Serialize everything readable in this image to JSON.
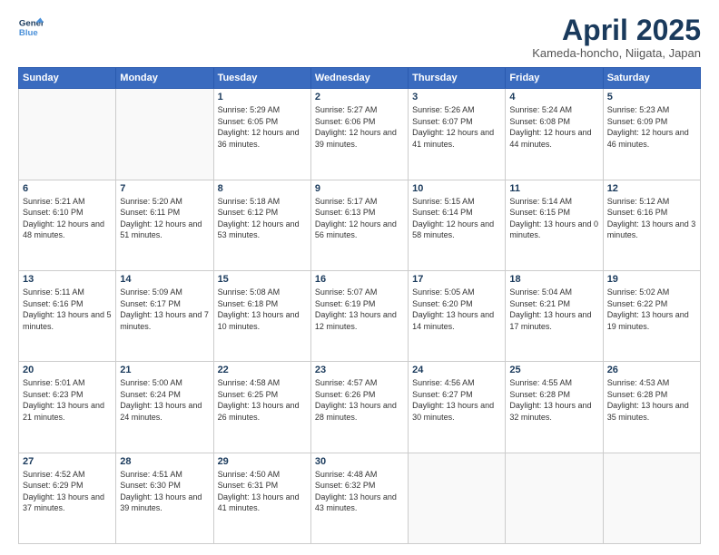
{
  "header": {
    "logo_line1": "General",
    "logo_line2": "Blue",
    "month_title": "April 2025",
    "location": "Kameda-honcho, Niigata, Japan"
  },
  "weekdays": [
    "Sunday",
    "Monday",
    "Tuesday",
    "Wednesday",
    "Thursday",
    "Friday",
    "Saturday"
  ],
  "weeks": [
    [
      {
        "day": "",
        "empty": true
      },
      {
        "day": "",
        "empty": true
      },
      {
        "day": "1",
        "sunrise": "5:29 AM",
        "sunset": "6:05 PM",
        "daylight": "12 hours and 36 minutes."
      },
      {
        "day": "2",
        "sunrise": "5:27 AM",
        "sunset": "6:06 PM",
        "daylight": "12 hours and 39 minutes."
      },
      {
        "day": "3",
        "sunrise": "5:26 AM",
        "sunset": "6:07 PM",
        "daylight": "12 hours and 41 minutes."
      },
      {
        "day": "4",
        "sunrise": "5:24 AM",
        "sunset": "6:08 PM",
        "daylight": "12 hours and 44 minutes."
      },
      {
        "day": "5",
        "sunrise": "5:23 AM",
        "sunset": "6:09 PM",
        "daylight": "12 hours and 46 minutes."
      }
    ],
    [
      {
        "day": "6",
        "sunrise": "5:21 AM",
        "sunset": "6:10 PM",
        "daylight": "12 hours and 48 minutes."
      },
      {
        "day": "7",
        "sunrise": "5:20 AM",
        "sunset": "6:11 PM",
        "daylight": "12 hours and 51 minutes."
      },
      {
        "day": "8",
        "sunrise": "5:18 AM",
        "sunset": "6:12 PM",
        "daylight": "12 hours and 53 minutes."
      },
      {
        "day": "9",
        "sunrise": "5:17 AM",
        "sunset": "6:13 PM",
        "daylight": "12 hours and 56 minutes."
      },
      {
        "day": "10",
        "sunrise": "5:15 AM",
        "sunset": "6:14 PM",
        "daylight": "12 hours and 58 minutes."
      },
      {
        "day": "11",
        "sunrise": "5:14 AM",
        "sunset": "6:15 PM",
        "daylight": "13 hours and 0 minutes."
      },
      {
        "day": "12",
        "sunrise": "5:12 AM",
        "sunset": "6:16 PM",
        "daylight": "13 hours and 3 minutes."
      }
    ],
    [
      {
        "day": "13",
        "sunrise": "5:11 AM",
        "sunset": "6:16 PM",
        "daylight": "13 hours and 5 minutes."
      },
      {
        "day": "14",
        "sunrise": "5:09 AM",
        "sunset": "6:17 PM",
        "daylight": "13 hours and 7 minutes."
      },
      {
        "day": "15",
        "sunrise": "5:08 AM",
        "sunset": "6:18 PM",
        "daylight": "13 hours and 10 minutes."
      },
      {
        "day": "16",
        "sunrise": "5:07 AM",
        "sunset": "6:19 PM",
        "daylight": "13 hours and 12 minutes."
      },
      {
        "day": "17",
        "sunrise": "5:05 AM",
        "sunset": "6:20 PM",
        "daylight": "13 hours and 14 minutes."
      },
      {
        "day": "18",
        "sunrise": "5:04 AM",
        "sunset": "6:21 PM",
        "daylight": "13 hours and 17 minutes."
      },
      {
        "day": "19",
        "sunrise": "5:02 AM",
        "sunset": "6:22 PM",
        "daylight": "13 hours and 19 minutes."
      }
    ],
    [
      {
        "day": "20",
        "sunrise": "5:01 AM",
        "sunset": "6:23 PM",
        "daylight": "13 hours and 21 minutes."
      },
      {
        "day": "21",
        "sunrise": "5:00 AM",
        "sunset": "6:24 PM",
        "daylight": "13 hours and 24 minutes."
      },
      {
        "day": "22",
        "sunrise": "4:58 AM",
        "sunset": "6:25 PM",
        "daylight": "13 hours and 26 minutes."
      },
      {
        "day": "23",
        "sunrise": "4:57 AM",
        "sunset": "6:26 PM",
        "daylight": "13 hours and 28 minutes."
      },
      {
        "day": "24",
        "sunrise": "4:56 AM",
        "sunset": "6:27 PM",
        "daylight": "13 hours and 30 minutes."
      },
      {
        "day": "25",
        "sunrise": "4:55 AM",
        "sunset": "6:28 PM",
        "daylight": "13 hours and 32 minutes."
      },
      {
        "day": "26",
        "sunrise": "4:53 AM",
        "sunset": "6:28 PM",
        "daylight": "13 hours and 35 minutes."
      }
    ],
    [
      {
        "day": "27",
        "sunrise": "4:52 AM",
        "sunset": "6:29 PM",
        "daylight": "13 hours and 37 minutes."
      },
      {
        "day": "28",
        "sunrise": "4:51 AM",
        "sunset": "6:30 PM",
        "daylight": "13 hours and 39 minutes."
      },
      {
        "day": "29",
        "sunrise": "4:50 AM",
        "sunset": "6:31 PM",
        "daylight": "13 hours and 41 minutes."
      },
      {
        "day": "30",
        "sunrise": "4:48 AM",
        "sunset": "6:32 PM",
        "daylight": "13 hours and 43 minutes."
      },
      {
        "day": "",
        "empty": true
      },
      {
        "day": "",
        "empty": true
      },
      {
        "day": "",
        "empty": true
      }
    ]
  ]
}
